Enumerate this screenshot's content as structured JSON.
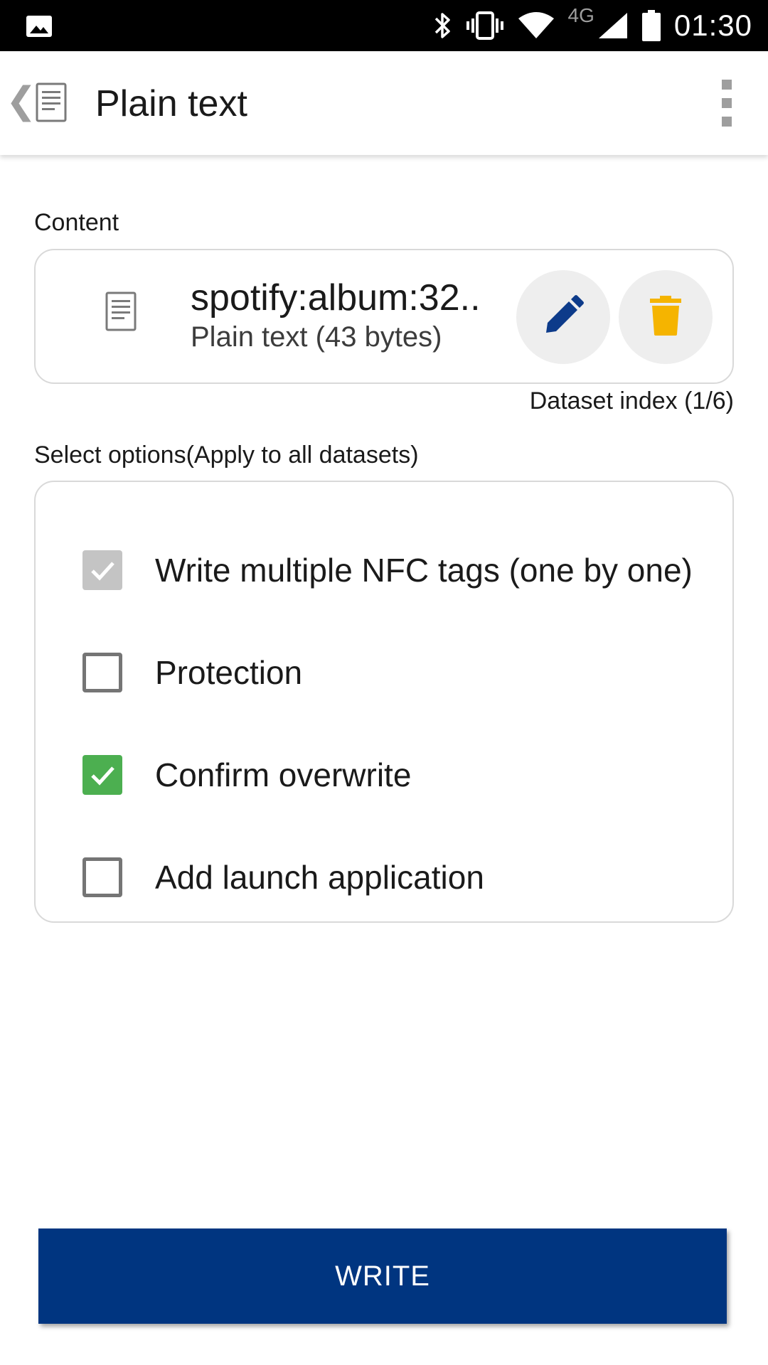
{
  "status_bar": {
    "time": "01:30",
    "network": "4G",
    "icons": [
      "image-icon",
      "bluetooth-icon",
      "vibrate-icon",
      "wifi-icon",
      "signal-icon",
      "battery-icon"
    ]
  },
  "app_bar": {
    "back_icon": "chevron-left-icon",
    "app_icon": "document-icon",
    "title": "Plain text",
    "menu_icon": "overflow-menu-icon"
  },
  "content_section": {
    "label": "Content",
    "item": {
      "icon": "document-icon",
      "title": "spotify:album:32..",
      "subtitle": "Plain text (43 bytes)",
      "edit_icon": "pencil-icon",
      "delete_icon": "trash-icon"
    },
    "dataset_index": "Dataset index (1/6)"
  },
  "options_section": {
    "label": "Select options(Apply to all datasets)",
    "options": [
      {
        "label": "Write multiple NFC tags (one by one)",
        "checked": true,
        "enabled": false
      },
      {
        "label": "Protection",
        "checked": false,
        "enabled": true
      },
      {
        "label": "Confirm overwrite",
        "checked": true,
        "enabled": true
      },
      {
        "label": "Add launch application",
        "checked": false,
        "enabled": true
      }
    ]
  },
  "write_button": {
    "label": "WRITE"
  },
  "colors": {
    "primary": "#003580",
    "edit_icon": "#0d3b8a",
    "delete_icon": "#f5b400",
    "checkbox_checked": "#4caf50",
    "checkbox_disabled": "#c4c4c4"
  }
}
